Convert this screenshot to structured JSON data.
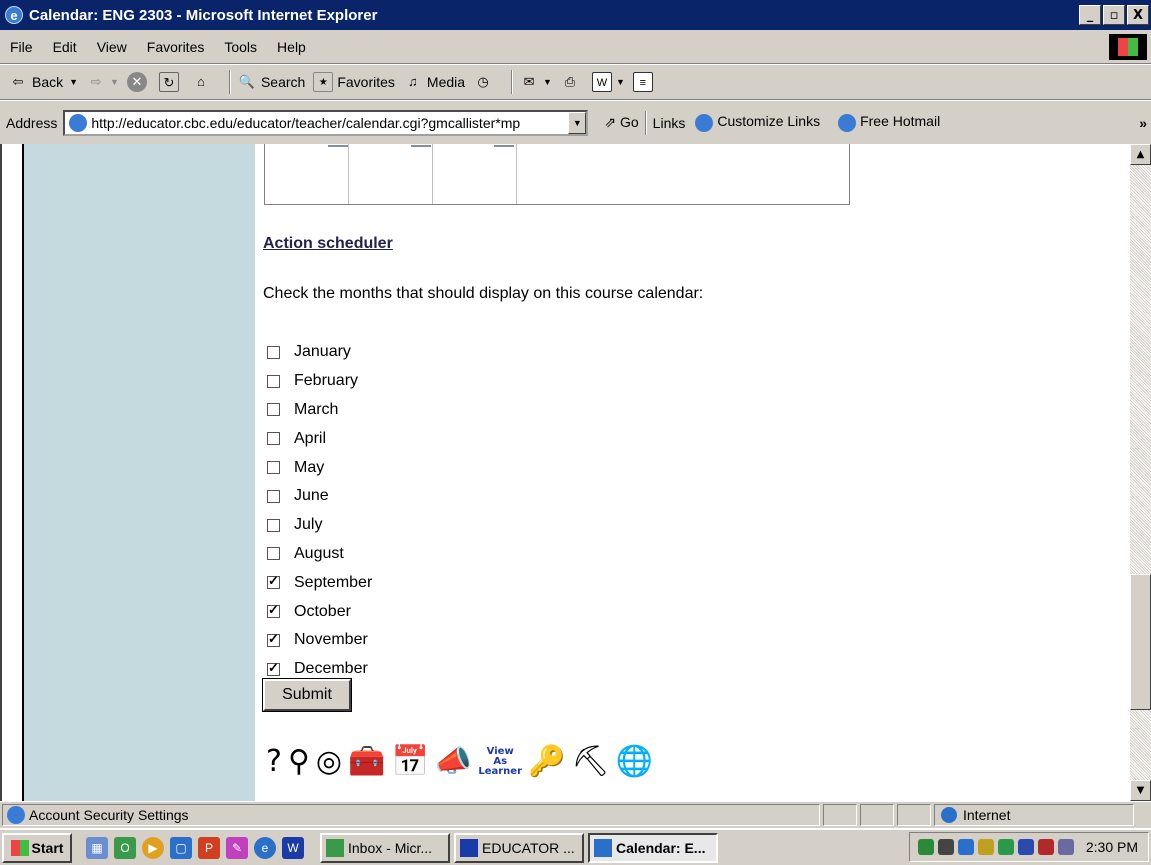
{
  "window": {
    "title": "Calendar: ENG 2303 - Microsoft Internet Explorer",
    "controls": [
      "_",
      "▫",
      "X"
    ]
  },
  "menu": [
    "File",
    "Edit",
    "View",
    "Favorites",
    "Tools",
    "Help"
  ],
  "toolbar": {
    "back": "Back",
    "search": "Search",
    "favorites": "Favorites",
    "media": "Media"
  },
  "address": {
    "label": "Address",
    "url": "http://educator.cbc.edu/educator/teacher/calendar.cgi?gmcallister*mp",
    "go": "Go",
    "links_label": "Links",
    "links": [
      "Customize Links",
      "Free Hotmail"
    ],
    "overflow": "»"
  },
  "page": {
    "heading": "Action scheduler",
    "instructions": "Check the months that should display on this course calendar:",
    "months": [
      {
        "label": "January",
        "checked": false
      },
      {
        "label": "February",
        "checked": false
      },
      {
        "label": "March",
        "checked": false
      },
      {
        "label": "April",
        "checked": false
      },
      {
        "label": "May",
        "checked": false
      },
      {
        "label": "June",
        "checked": false
      },
      {
        "label": "July",
        "checked": false
      },
      {
        "label": "August",
        "checked": false
      },
      {
        "label": "September",
        "checked": true
      },
      {
        "label": "October",
        "checked": true
      },
      {
        "label": "November",
        "checked": true
      },
      {
        "label": "December",
        "checked": true
      }
    ],
    "submit": "Submit",
    "tool_icons": [
      {
        "name": "help-icon",
        "glyph": "?"
      },
      {
        "name": "magnifier-icon",
        "glyph": "⚲"
      },
      {
        "name": "compass-icon",
        "glyph": "◎"
      },
      {
        "name": "toolbox-icon",
        "glyph": "🧰"
      },
      {
        "name": "calendar-icon",
        "glyph": "📅"
      },
      {
        "name": "megaphone-icon",
        "glyph": "📣"
      },
      {
        "name": "view-as-learner-icon",
        "glyph": "View As Learner"
      },
      {
        "name": "keys-icon",
        "glyph": "🔑"
      },
      {
        "name": "wheelbarrow-icon",
        "glyph": "⛏"
      },
      {
        "name": "globe-icon",
        "glyph": "🌐"
      }
    ]
  },
  "status": {
    "text": "Account Security Settings",
    "zone": "Internet"
  },
  "taskbar": {
    "start": "Start",
    "tasks": [
      {
        "label": "Inbox - Micr...",
        "active": false
      },
      {
        "label": "EDUCATOR ...",
        "active": false
      },
      {
        "label": "Calendar: E...",
        "active": true
      }
    ],
    "clock": "2:30 PM"
  }
}
